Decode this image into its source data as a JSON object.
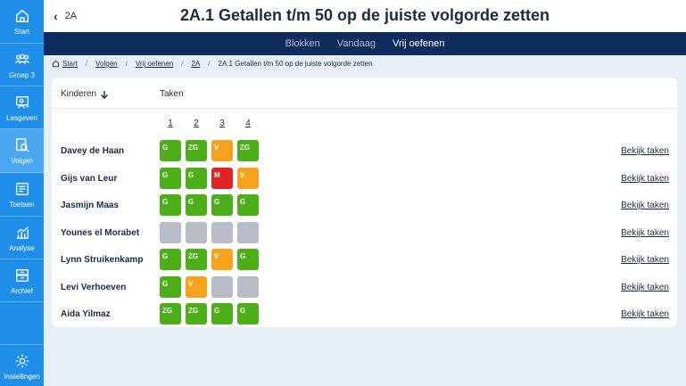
{
  "sidebar": {
    "items": [
      {
        "label": "Start",
        "icon": "home-icon",
        "active": false
      },
      {
        "label": "Groep 3",
        "icon": "group-icon",
        "active": false
      },
      {
        "label": "Lesgeven",
        "icon": "teach-icon",
        "active": false
      },
      {
        "label": "Volgen",
        "icon": "follow-icon",
        "active": true
      },
      {
        "label": "Toetsen",
        "icon": "test-icon",
        "active": false
      },
      {
        "label": "Analyse",
        "icon": "chart-icon",
        "active": false
      },
      {
        "label": "Archief",
        "icon": "archive-icon",
        "active": false
      }
    ],
    "settings": {
      "label": "Instellingen",
      "icon": "gear-icon"
    }
  },
  "header": {
    "back_label": "2A",
    "title": "2A.1 Getallen t/m 50 op de juiste volgorde zetten"
  },
  "subnav": {
    "tabs": [
      {
        "label": "Blokken",
        "active": false
      },
      {
        "label": "Vandaag",
        "active": false
      },
      {
        "label": "Vrij oefenen",
        "active": true
      }
    ]
  },
  "breadcrumb": [
    "Start",
    "Volgen",
    "Vrij oefenen",
    "2A",
    "2A.1 Getallen t/m 50 op de juiste volgorde zetten"
  ],
  "table": {
    "col_children": "Kinderen",
    "col_tasks": "Taken",
    "task_numbers": [
      "1",
      "2",
      "3",
      "4"
    ],
    "view_label": "Bekijk taken",
    "rows": [
      {
        "name": "Davey de Haan",
        "cells": [
          {
            "label": "G",
            "status": "green"
          },
          {
            "label": "ZG",
            "status": "green"
          },
          {
            "label": "V",
            "status": "orange"
          },
          {
            "label": "ZG",
            "status": "green"
          }
        ]
      },
      {
        "name": "Gijs van Leur",
        "cells": [
          {
            "label": "G",
            "status": "green"
          },
          {
            "label": "G",
            "status": "green"
          },
          {
            "label": "M",
            "status": "red"
          },
          {
            "label": "V",
            "status": "orange"
          }
        ]
      },
      {
        "name": "Jasmijn Maas",
        "cells": [
          {
            "label": "G",
            "status": "green"
          },
          {
            "label": "G",
            "status": "green"
          },
          {
            "label": "G",
            "status": "green"
          },
          {
            "label": "G",
            "status": "green"
          }
        ]
      },
      {
        "name": "Younes el Morabet",
        "cells": [
          {
            "label": "",
            "status": "gray"
          },
          {
            "label": "",
            "status": "gray"
          },
          {
            "label": "",
            "status": "gray"
          },
          {
            "label": "",
            "status": "gray"
          }
        ]
      },
      {
        "name": "Lynn Struikenkamp",
        "cells": [
          {
            "label": "G",
            "status": "green"
          },
          {
            "label": "ZG",
            "status": "green"
          },
          {
            "label": "V",
            "status": "orange"
          },
          {
            "label": "G",
            "status": "green"
          }
        ]
      },
      {
        "name": "Levi Verhoeven",
        "cells": [
          {
            "label": "G",
            "status": "green"
          },
          {
            "label": "V",
            "status": "orange"
          },
          {
            "label": "",
            "status": "gray"
          },
          {
            "label": "",
            "status": "gray"
          }
        ]
      },
      {
        "name": "Aida Yilmaz",
        "cells": [
          {
            "label": "ZG",
            "status": "green"
          },
          {
            "label": "ZG",
            "status": "green"
          },
          {
            "label": "G",
            "status": "green"
          },
          {
            "label": "G",
            "status": "green"
          }
        ]
      }
    ]
  },
  "colors": {
    "sidebar": "#1f8ee8",
    "sidebar_active": "#4aa8f2",
    "subnav": "#0e2c5c",
    "green": "#4caf1a",
    "orange": "#f7a21b",
    "red": "#e02424",
    "gray": "#b7bcc6"
  }
}
